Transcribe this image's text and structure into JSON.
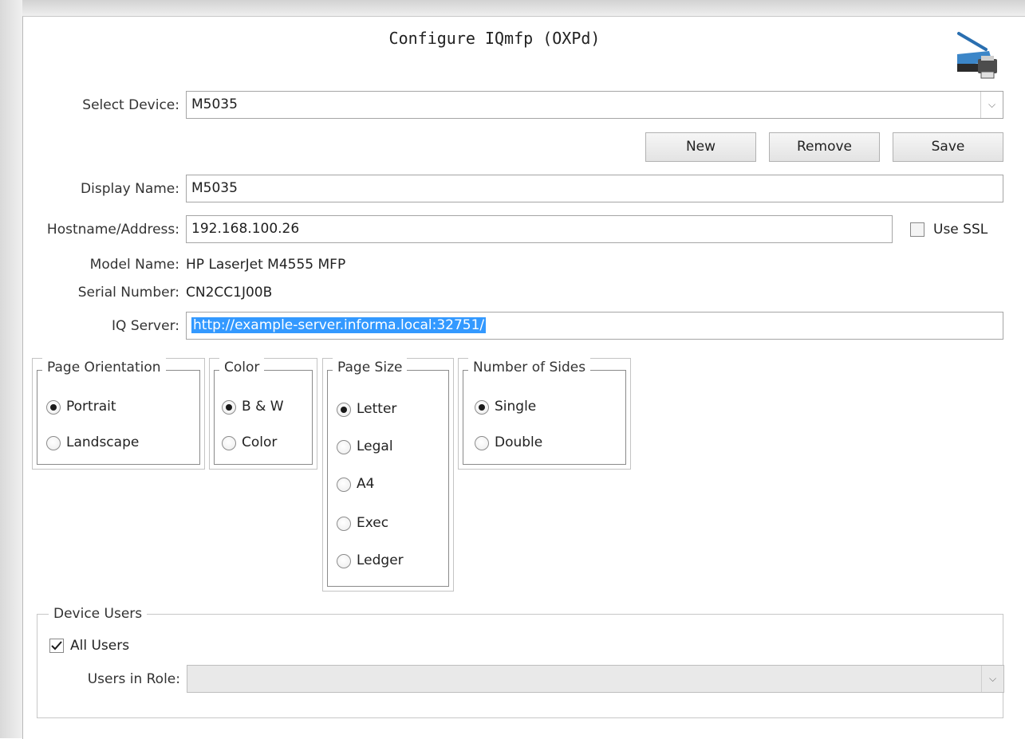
{
  "title": "Configure IQmfp (OXPd)",
  "app_icon": "scanner-printer-icon",
  "select_device": {
    "label": "Select Device:",
    "value": "M5035"
  },
  "buttons": {
    "new": "New",
    "remove": "Remove",
    "save": "Save"
  },
  "display_name": {
    "label": "Display Name:",
    "value": "M5035"
  },
  "hostname": {
    "label": "Hostname/Address:",
    "value": "192.168.100.26"
  },
  "use_ssl": {
    "label": "Use SSL",
    "checked": false
  },
  "model_name": {
    "label": "Model Name:",
    "value": "HP LaserJet M4555 MFP"
  },
  "serial_number": {
    "label": "Serial Number:",
    "value": "CN2CC1J00B"
  },
  "iq_server": {
    "label": "IQ Server:",
    "value": "http://example-server.informa.local:32751/"
  },
  "groups": {
    "orientation": {
      "title": "Page Orientation",
      "options": [
        "Portrait",
        "Landscape"
      ],
      "selected": "Portrait"
    },
    "color": {
      "title": "Color",
      "options": [
        "B & W",
        "Color"
      ],
      "selected": "B & W"
    },
    "page_size": {
      "title": "Page Size",
      "options": [
        "Letter",
        "Legal",
        "A4",
        "Exec",
        "Ledger"
      ],
      "selected": "Letter"
    },
    "sides": {
      "title": "Number of Sides",
      "options": [
        "Single",
        "Double"
      ],
      "selected": "Single"
    }
  },
  "device_users": {
    "title": "Device Users",
    "all_users": {
      "label": "All Users",
      "checked": true
    },
    "users_in_role": {
      "label": "Users in Role:",
      "value": ""
    }
  },
  "colors": {
    "selection": "#3399ff",
    "border": "#a5a5a5"
  }
}
